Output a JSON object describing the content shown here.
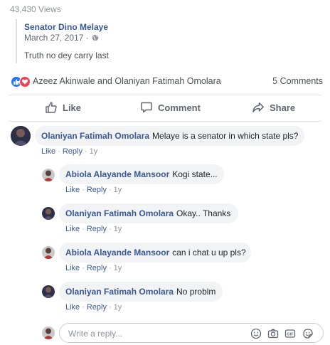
{
  "post": {
    "views": "43,430 Views",
    "shared": {
      "author": "Senator Dino Melaye",
      "date": "March 27, 2017 ·",
      "text": "Truth no dey carry last"
    }
  },
  "reactions": {
    "names": "Azeez Akinwale and Olaniyan Fatimah Omolara",
    "comments_count": "5 Comments",
    "icons": [
      "like-reaction",
      "love-reaction"
    ],
    "colors": {
      "like": "#2078f4",
      "love": "#f33e58"
    }
  },
  "actions": {
    "like": "Like",
    "comment": "Comment",
    "share": "Share"
  },
  "comments": [
    {
      "author": "Olaniyan Fatimah Omolara",
      "text": "Melaye is a senator in which state pls?",
      "like": "Like",
      "reply": "Reply",
      "time": "1y"
    }
  ],
  "replies": [
    {
      "author": "Abiola Alayande Mansoor",
      "text": "Kogi state...",
      "like": "Like",
      "reply": "Reply",
      "time": "1y"
    },
    {
      "author": "Olaniyan Fatimah Omolara",
      "text": "Okay.. Thanks",
      "like": "Like",
      "reply": "Reply",
      "time": "1y"
    },
    {
      "author": "Abiola Alayande Mansoor",
      "text": "can i chat u up pls?",
      "like": "Like",
      "reply": "Reply",
      "time": "1y"
    },
    {
      "author": "Olaniyan Fatimah Omolara",
      "text": "No problm",
      "like": "Like",
      "reply": "Reply",
      "time": "1y"
    }
  ],
  "reply_box": {
    "placeholder": "Write a reply...",
    "tools": [
      "emoji-icon",
      "camera-icon",
      "gif-icon",
      "sticker-icon"
    ]
  }
}
